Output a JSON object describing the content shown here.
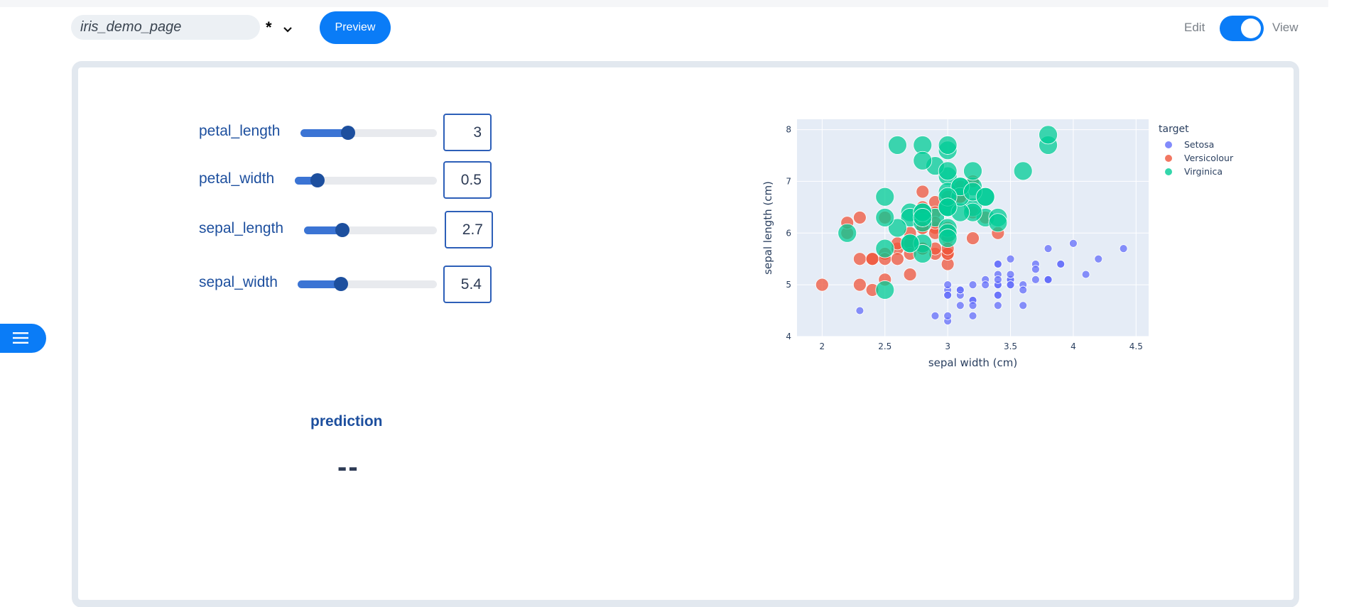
{
  "header": {
    "page_name": "iris_demo_page",
    "unsaved_mark": "*",
    "preview_label": "Preview",
    "edit_label": "Edit",
    "view_label": "View",
    "mode": "View"
  },
  "sliders": [
    {
      "label": "petal_length",
      "value": "3",
      "fraction": 0.35
    },
    {
      "label": "petal_width",
      "value": "0.5",
      "fraction": 0.16
    },
    {
      "label": "sepal_length",
      "value": "2.7",
      "fraction": 0.29
    },
    {
      "label": "sepal_width",
      "value": "5.4",
      "fraction": 0.31
    }
  ],
  "prediction": {
    "title": "prediction",
    "value": "--"
  },
  "colors": {
    "accent": "#0a7cf7",
    "label": "#1d4f9e",
    "setosa": "#636efa",
    "versicolour": "#ef553b",
    "virginica": "#00cc96"
  },
  "chart_data": {
    "type": "scatter",
    "xlabel": "sepal width (cm)",
    "ylabel": "sepal length (cm)",
    "xlim": [
      1.8,
      4.6
    ],
    "ylim": [
      4,
      8.2
    ],
    "xticks": [
      2,
      2.5,
      3,
      3.5,
      4,
      4.5
    ],
    "xtick_labels": [
      "2",
      "2.5",
      "3",
      "3.5",
      "4",
      "4.5"
    ],
    "yticks": [
      4,
      5,
      6,
      7,
      8
    ],
    "ytick_labels": [
      "4",
      "5",
      "6",
      "7",
      "8"
    ],
    "legend_title": "target",
    "legend_position": "top-right",
    "grid": true,
    "series": [
      {
        "name": "Setosa",
        "color": "#636efa",
        "size": "small",
        "points": [
          [
            3.5,
            5.1
          ],
          [
            3.0,
            4.9
          ],
          [
            3.2,
            4.7
          ],
          [
            3.1,
            4.6
          ],
          [
            3.6,
            5.0
          ],
          [
            3.9,
            5.4
          ],
          [
            3.4,
            4.6
          ],
          [
            3.4,
            5.0
          ],
          [
            2.9,
            4.4
          ],
          [
            3.1,
            4.9
          ],
          [
            3.7,
            5.4
          ],
          [
            3.4,
            4.8
          ],
          [
            3.0,
            4.8
          ],
          [
            3.0,
            4.3
          ],
          [
            4.0,
            5.8
          ],
          [
            4.4,
            5.7
          ],
          [
            3.9,
            5.4
          ],
          [
            3.5,
            5.1
          ],
          [
            3.8,
            5.7
          ],
          [
            3.8,
            5.1
          ],
          [
            3.4,
            5.4
          ],
          [
            3.7,
            5.1
          ],
          [
            3.6,
            4.6
          ],
          [
            3.3,
            5.1
          ],
          [
            3.4,
            4.8
          ],
          [
            3.0,
            5.0
          ],
          [
            3.4,
            5.0
          ],
          [
            3.5,
            5.2
          ],
          [
            3.4,
            5.2
          ],
          [
            3.2,
            4.7
          ],
          [
            3.1,
            4.8
          ],
          [
            3.4,
            5.4
          ],
          [
            4.1,
            5.2
          ],
          [
            4.2,
            5.5
          ],
          [
            3.1,
            4.9
          ],
          [
            3.2,
            5.0
          ],
          [
            3.5,
            5.5
          ],
          [
            3.6,
            4.9
          ],
          [
            3.0,
            4.4
          ],
          [
            3.4,
            5.1
          ],
          [
            3.5,
            5.0
          ],
          [
            2.3,
            4.5
          ],
          [
            3.2,
            4.4
          ],
          [
            3.5,
            5.0
          ],
          [
            3.8,
            5.1
          ],
          [
            3.0,
            4.8
          ],
          [
            3.8,
            5.1
          ],
          [
            3.2,
            4.6
          ],
          [
            3.7,
            5.3
          ],
          [
            3.3,
            5.0
          ]
        ]
      },
      {
        "name": "Versicolour",
        "color": "#ef553b",
        "size": "medium",
        "points": [
          [
            3.2,
            7.0
          ],
          [
            3.2,
            6.4
          ],
          [
            3.1,
            6.9
          ],
          [
            2.3,
            5.5
          ],
          [
            2.8,
            6.5
          ],
          [
            2.8,
            5.7
          ],
          [
            3.3,
            6.3
          ],
          [
            2.4,
            4.9
          ],
          [
            2.9,
            6.6
          ],
          [
            2.7,
            5.2
          ],
          [
            2.0,
            5.0
          ],
          [
            3.0,
            5.9
          ],
          [
            2.2,
            6.0
          ],
          [
            2.9,
            6.1
          ],
          [
            2.9,
            5.6
          ],
          [
            3.1,
            6.7
          ],
          [
            3.0,
            5.6
          ],
          [
            2.7,
            5.8
          ],
          [
            2.2,
            6.2
          ],
          [
            2.5,
            5.6
          ],
          [
            3.2,
            5.9
          ],
          [
            2.8,
            6.1
          ],
          [
            2.5,
            6.3
          ],
          [
            2.8,
            6.1
          ],
          [
            2.9,
            6.4
          ],
          [
            3.0,
            6.6
          ],
          [
            2.8,
            6.8
          ],
          [
            3.0,
            6.7
          ],
          [
            2.9,
            6.0
          ],
          [
            2.6,
            5.7
          ],
          [
            2.4,
            5.5
          ],
          [
            2.4,
            5.5
          ],
          [
            2.7,
            5.8
          ],
          [
            2.7,
            6.0
          ],
          [
            3.0,
            5.4
          ],
          [
            3.4,
            6.0
          ],
          [
            3.1,
            6.7
          ],
          [
            2.3,
            6.3
          ],
          [
            3.0,
            5.6
          ],
          [
            2.5,
            5.5
          ],
          [
            2.6,
            5.5
          ],
          [
            3.0,
            6.1
          ],
          [
            2.6,
            5.8
          ],
          [
            2.3,
            5.0
          ],
          [
            2.7,
            5.6
          ],
          [
            3.0,
            5.7
          ],
          [
            2.9,
            5.7
          ],
          [
            2.9,
            6.2
          ],
          [
            2.5,
            5.1
          ],
          [
            2.8,
            5.7
          ]
        ]
      },
      {
        "name": "Virginica",
        "color": "#00cc96",
        "size": "large",
        "points": [
          [
            3.3,
            6.3
          ],
          [
            2.7,
            5.8
          ],
          [
            3.0,
            7.1
          ],
          [
            2.9,
            6.3
          ],
          [
            3.0,
            6.5
          ],
          [
            3.0,
            7.6
          ],
          [
            2.5,
            4.9
          ],
          [
            2.9,
            7.3
          ],
          [
            2.5,
            6.7
          ],
          [
            3.6,
            7.2
          ],
          [
            3.2,
            6.5
          ],
          [
            2.7,
            6.4
          ],
          [
            3.0,
            6.8
          ],
          [
            2.5,
            5.7
          ],
          [
            2.8,
            5.8
          ],
          [
            3.2,
            6.4
          ],
          [
            3.0,
            6.5
          ],
          [
            3.8,
            7.7
          ],
          [
            2.6,
            7.7
          ],
          [
            2.2,
            6.0
          ],
          [
            3.2,
            6.9
          ],
          [
            2.8,
            5.6
          ],
          [
            2.8,
            7.7
          ],
          [
            2.7,
            6.3
          ],
          [
            3.3,
            6.7
          ],
          [
            3.2,
            7.2
          ],
          [
            2.8,
            6.2
          ],
          [
            3.0,
            6.1
          ],
          [
            2.8,
            6.4
          ],
          [
            3.0,
            7.2
          ],
          [
            2.8,
            7.4
          ],
          [
            3.8,
            7.9
          ],
          [
            2.8,
            6.4
          ],
          [
            2.8,
            6.3
          ],
          [
            2.6,
            6.1
          ],
          [
            3.0,
            7.7
          ],
          [
            3.4,
            6.3
          ],
          [
            3.1,
            6.4
          ],
          [
            3.0,
            6.0
          ],
          [
            3.1,
            6.9
          ],
          [
            3.1,
            6.7
          ],
          [
            3.1,
            6.9
          ],
          [
            2.7,
            5.8
          ],
          [
            3.2,
            6.8
          ],
          [
            3.3,
            6.7
          ],
          [
            3.0,
            6.7
          ],
          [
            2.5,
            6.3
          ],
          [
            3.0,
            6.5
          ],
          [
            3.4,
            6.2
          ],
          [
            3.0,
            5.9
          ]
        ]
      }
    ]
  }
}
